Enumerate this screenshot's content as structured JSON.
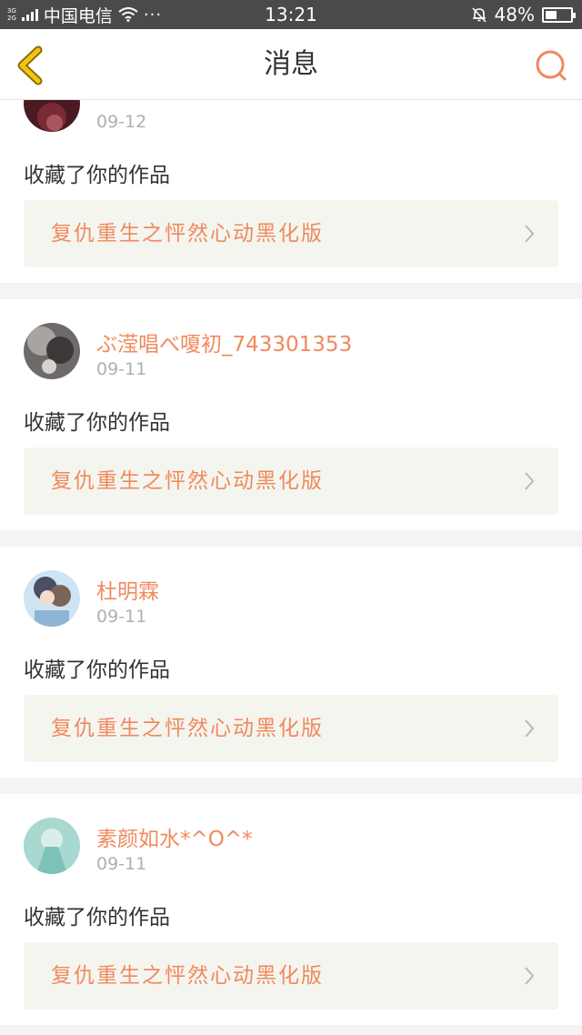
{
  "status_bar": {
    "network_top": "3G",
    "network_bottom": "2G",
    "carrier": "中国电信",
    "more": "···",
    "time": "13:21",
    "battery_percent_label": "48%",
    "battery_level": 0.48
  },
  "nav": {
    "title": "消息",
    "back_icon": "chevron-left-icon",
    "search_icon": "search-icon",
    "accent": "#f2c417",
    "search_color": "#f08a5d"
  },
  "colors": {
    "username": "#f08a5d",
    "work_title": "#f08a5d",
    "date": "#b0b0b0",
    "card_bg": "#ffffff",
    "work_bg": "#f5f5f0"
  },
  "messages": [
    {
      "username": "",
      "date": "09-12",
      "action": "收藏了你的作品",
      "work_title": "复仇重生之怦然心动黑化版",
      "avatar": "dark-red"
    },
    {
      "username": "ぶ滢唱べ嗄初_743301353",
      "date": "09-11",
      "action": "收藏了你的作品",
      "work_title": "复仇重生之怦然心动黑化版",
      "avatar": "gray"
    },
    {
      "username": "杜明霖",
      "date": "09-11",
      "action": "收藏了你的作品",
      "work_title": "复仇重生之怦然心动黑化版",
      "avatar": "blue"
    },
    {
      "username": "素颜如水*^O^*",
      "date": "09-11",
      "action": "收藏了你的作品",
      "work_title": "复仇重生之怦然心动黑化版",
      "avatar": "teal"
    }
  ]
}
